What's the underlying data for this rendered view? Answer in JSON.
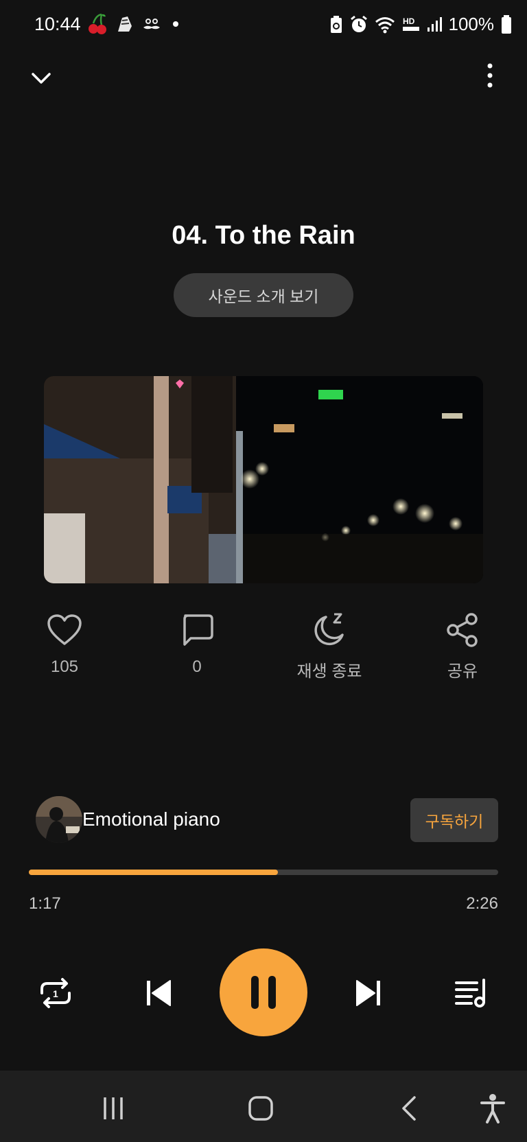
{
  "status_bar": {
    "time": "10:44",
    "battery": "100%",
    "icons": [
      "cherry-icon",
      "notification-icon",
      "mustache-icon",
      "dot-icon",
      "battery-saver-icon",
      "alarm-icon",
      "wifi-icon",
      "hd-voice-icon",
      "signal-icon",
      "battery-icon"
    ],
    "hd_voice_label": "HD"
  },
  "track": {
    "title": "04. To the Rain",
    "intro_button": "사운드 소개 보기"
  },
  "actions": [
    {
      "icon": "heart-icon",
      "label": "105"
    },
    {
      "icon": "comment-icon",
      "label": "0"
    },
    {
      "icon": "sleep-timer-icon",
      "label": "재생 종료"
    },
    {
      "icon": "share-icon",
      "label": "공유"
    }
  ],
  "channel": {
    "name": "Emotional piano",
    "subscribe_label": "구독하기"
  },
  "player": {
    "elapsed": "1:17",
    "duration": "2:26",
    "progress_fraction": 0.53
  },
  "colors": {
    "accent": "#f8a53d",
    "background": "#121212",
    "button_bg": "#3a3a3a"
  }
}
